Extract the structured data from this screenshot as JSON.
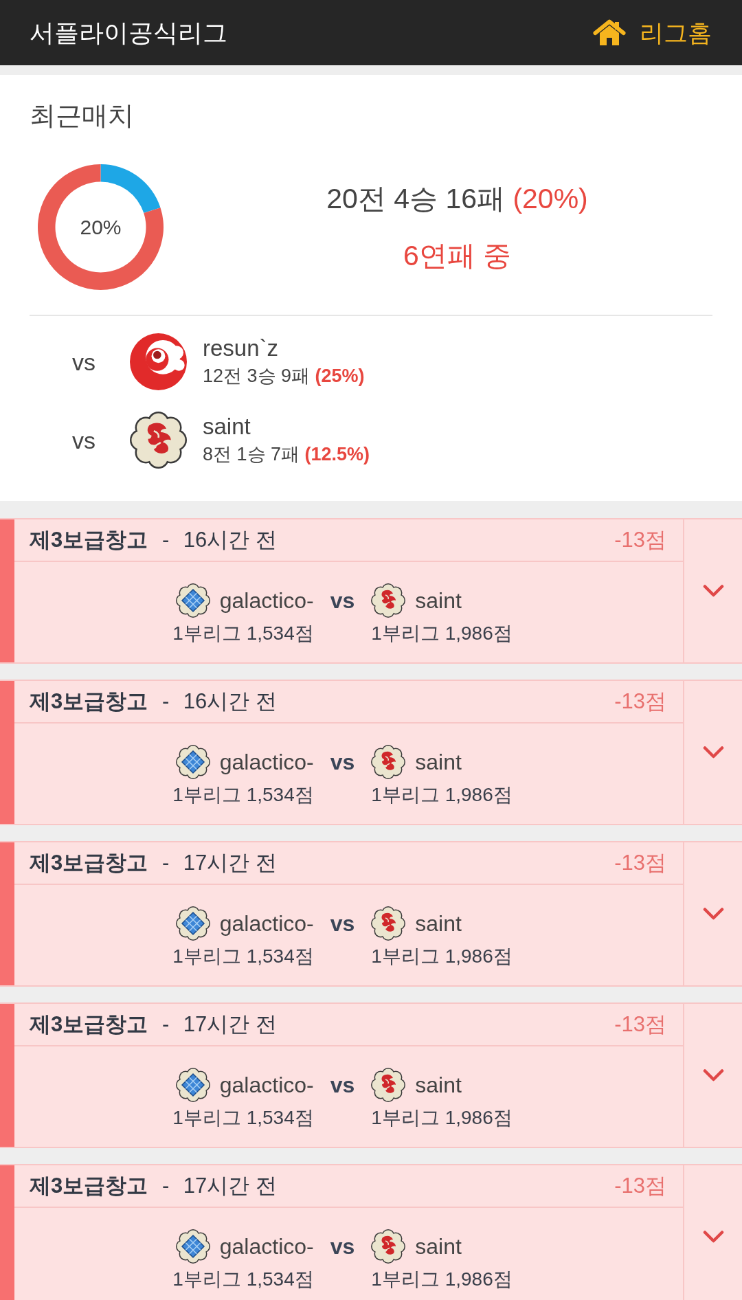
{
  "header": {
    "title": "서플라이공식리그",
    "home_link": "리그홈"
  },
  "summary": {
    "title": "최근매치",
    "chart_data": {
      "type": "donut",
      "values": [
        20,
        80
      ]
    },
    "ring_label": "20%",
    "record": "20전 4승 16패",
    "rate": "(20%)",
    "streak": "6연패 중"
  },
  "opponents": [
    {
      "prefix": "vs",
      "kind": "swirl",
      "name": "resun`z",
      "record": "12전 3승 9패",
      "rate": "(25%)"
    },
    {
      "prefix": "vs",
      "kind": "dragon",
      "name": "saint",
      "record": "8전 1승 7패",
      "rate": "(12.5%)"
    }
  ],
  "matches": [
    {
      "kind": "loss",
      "map": "제3보급창고",
      "separator": "-",
      "time": "16시간 전",
      "points": "-13점",
      "home": {
        "kind": "diamond",
        "name": "galactico-",
        "league": "1부리그 1,534점"
      },
      "vs": "vs",
      "away": {
        "kind": "dragon",
        "name": "saint",
        "league": "1부리그 1,986점"
      },
      "expanded": false
    },
    {
      "kind": "loss",
      "map": "제3보급창고",
      "separator": "-",
      "time": "16시간 전",
      "points": "-13점",
      "home": {
        "kind": "diamond",
        "name": "galactico-",
        "league": "1부리그 1,534점"
      },
      "vs": "vs",
      "away": {
        "kind": "dragon",
        "name": "saint",
        "league": "1부리그 1,986점"
      },
      "expanded": false
    },
    {
      "kind": "loss",
      "map": "제3보급창고",
      "separator": "-",
      "time": "17시간 전",
      "points": "-13점",
      "home": {
        "kind": "diamond",
        "name": "galactico-",
        "league": "1부리그 1,534점"
      },
      "vs": "vs",
      "away": {
        "kind": "dragon",
        "name": "saint",
        "league": "1부리그 1,986점"
      },
      "expanded": false
    },
    {
      "kind": "loss",
      "map": "제3보급창고",
      "separator": "-",
      "time": "17시간 전",
      "points": "-13점",
      "home": {
        "kind": "diamond",
        "name": "galactico-",
        "league": "1부리그 1,534점"
      },
      "vs": "vs",
      "away": {
        "kind": "dragon",
        "name": "saint",
        "league": "1부리그 1,986점"
      },
      "expanded": false
    },
    {
      "kind": "loss",
      "map": "제3보급창고",
      "separator": "-",
      "time": "17시간 전",
      "points": "-13점",
      "home": {
        "kind": "diamond",
        "name": "galactico-",
        "league": "1부리그 1,534점"
      },
      "vs": "vs",
      "away": {
        "kind": "dragon",
        "name": "saint",
        "league": "1부리그 1,986점"
      },
      "expanded": false
    }
  ]
}
